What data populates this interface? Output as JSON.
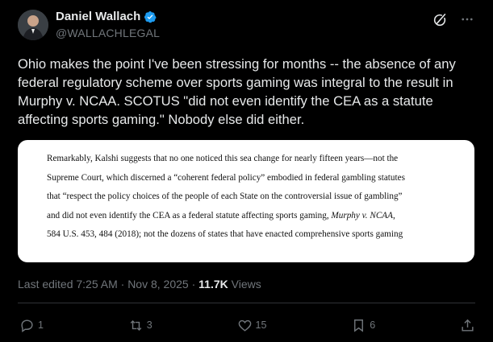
{
  "author": {
    "display_name": "Daniel Wallach",
    "handle": "@WALLACHLEGAL"
  },
  "post": {
    "text": "Ohio makes the point I've been stressing for months -- the absence of any federal regulatory scheme over sports gaming was integral to the result in Murphy v. NCAA. SCOTUS \"did not even identify the CEA as a statute affecting sports gaming.\" Nobody else did either.",
    "quote_lines": [
      "Remarkably, Kalshi suggests that no one noticed this sea change for nearly fifteen years—not the",
      "Supreme Court, which discerned a “coherent federal policy” embodied in federal gambling statutes",
      "that “respect the policy choices of the people of each State on the controversial issue of gambling”",
      "and did not even identify the CEA as a federal statute affecting sports gaming,",
      "584 U.S. 453, 484 (2018); not the dozens of states that have enacted comprehensive sports gaming"
    ],
    "quote_italic": "Murphy v. NCAA",
    "quote_after_italic": ",",
    "edited_label": "Last edited 7:25 AM · Nov 8, 2025 · ",
    "views_count": "11.7K",
    "views_label": " Views"
  },
  "actions": {
    "replies": "1",
    "reposts": "3",
    "likes": "15",
    "bookmarks": "6"
  },
  "colors": {
    "background": "#000000",
    "text": "#e7e9ea",
    "muted": "#71767b",
    "verified": "#1d9bf0"
  }
}
